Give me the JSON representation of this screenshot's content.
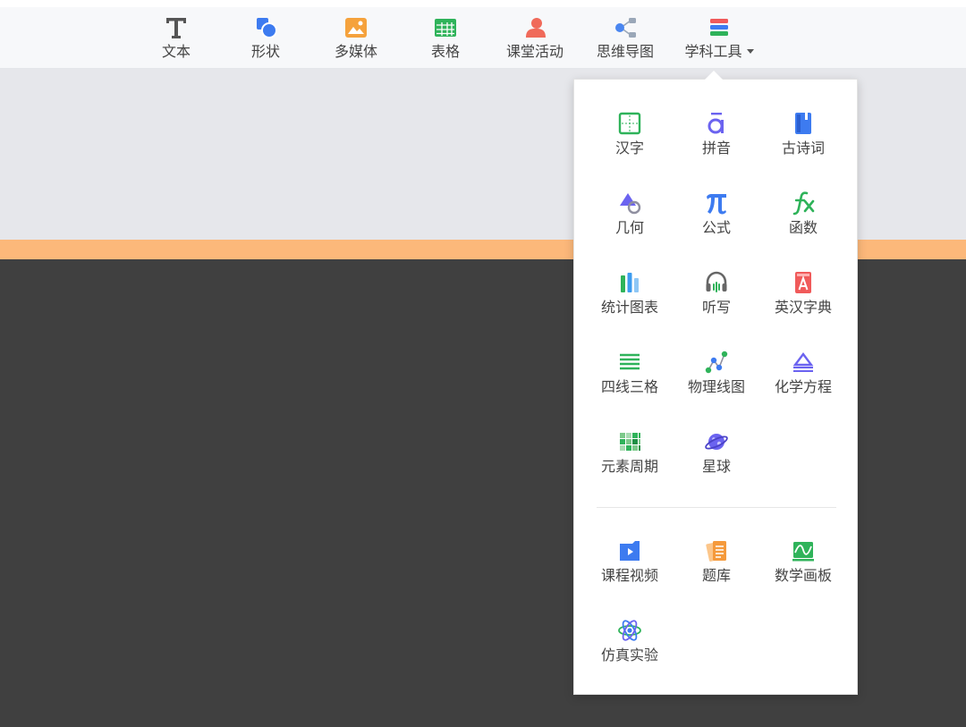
{
  "toolbar": {
    "text": "文本",
    "shape": "形状",
    "media": "多媒体",
    "table": "表格",
    "activity": "课堂活动",
    "mindmap": "思维导图",
    "subject_tools": "学科工具"
  },
  "menu": {
    "hanzi": "汉字",
    "pinyin": "拼音",
    "poetry": "古诗词",
    "geometry": "几何",
    "formula": "公式",
    "function": "函数",
    "stats_chart": "统计图表",
    "dictation": "听写",
    "dictionary": "英汉字典",
    "four_line": "四线三格",
    "physics_graph": "物理线图",
    "chem_equation": "化学方程",
    "periodic_table": "元素周期",
    "planet": "星球",
    "course_video": "课程视频",
    "question_bank": "题库",
    "math_board": "数学画板",
    "simulation": "仿真实验"
  },
  "colors": {
    "accent_blue": "#4a7cf0",
    "orange_bar": "#fcb87a",
    "dark_bg": "#404040",
    "canvas_bg": "#e6e7eb"
  }
}
